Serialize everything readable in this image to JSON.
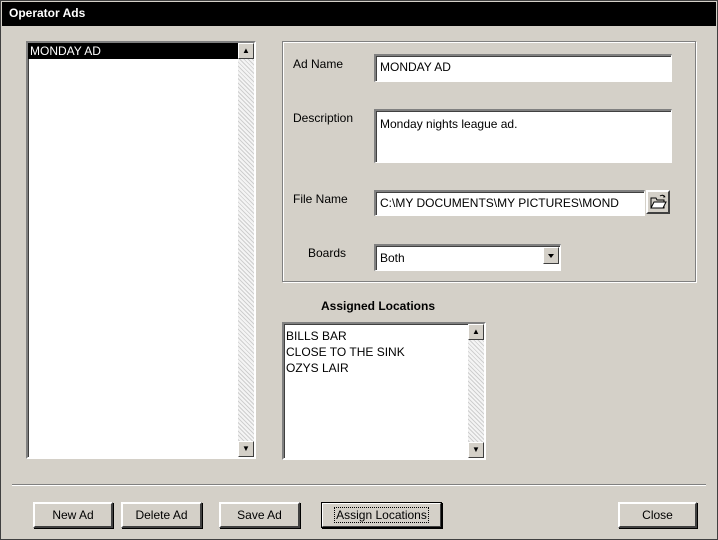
{
  "window": {
    "title": "Operator Ads"
  },
  "ads_list": {
    "items": [
      "MONDAY AD"
    ],
    "selected_index": 0
  },
  "details": {
    "ad_name_label": "Ad Name",
    "ad_name_value": "MONDAY AD",
    "description_label": "Description",
    "description_value": "Monday nights league ad.",
    "file_name_label": "File Name",
    "file_name_value": "C:\\MY DOCUMENTS\\MY PICTURES\\MOND",
    "boards_label": "Boards",
    "boards_value": "Both"
  },
  "locations": {
    "heading": "Assigned Locations",
    "items": [
      "BILLS BAR",
      "CLOSE TO THE SINK",
      "OZYS LAIR"
    ]
  },
  "buttons": {
    "new_ad": "New Ad",
    "delete_ad": "Delete Ad",
    "save_ad": "Save Ad",
    "assign_locations": "Assign Locations",
    "close": "Close"
  },
  "icons": {
    "browse": "folder-open-icon",
    "scroll_up": "arrow-up-icon",
    "scroll_down": "arrow-down-icon",
    "dropdown": "chevron-down-icon"
  }
}
